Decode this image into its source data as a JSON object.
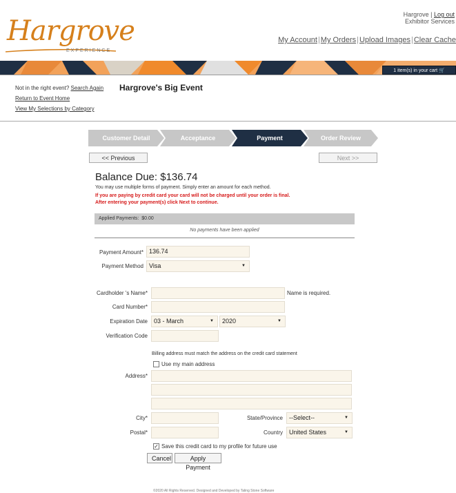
{
  "header": {
    "user_name": "Hargrove",
    "logout": "Log out",
    "exhibitor_services": "Exhibitor Services",
    "nav": [
      "My Account",
      "My Orders",
      "Upload Images",
      "Clear Cache"
    ],
    "logo_text": "Hargrove",
    "logo_sub": "EXPERIENCE",
    "cart": "1 item(s) in your cart"
  },
  "sidebar": {
    "wrong_event": "Not in the right event?",
    "search_again": "Search Again",
    "return_home": "Return to Event Home",
    "view_selections": "View My Selections by Category"
  },
  "event_title": "Hargrove's Big Event",
  "steps": [
    {
      "label": "Customer Detail"
    },
    {
      "label": "Acceptance"
    },
    {
      "label": "Payment"
    },
    {
      "label": "Order Review"
    }
  ],
  "nav_buttons": {
    "previous": "<< Previous",
    "next": "Next >>"
  },
  "balance": {
    "label": "Balance Due: $136.74",
    "note": "You may use multiple forms of payment. Simply enter an amount for each method.",
    "warn1": "If you are paying by credit card your card will not be charged until your order is final.",
    "warn2": "After entering your payment(s) click Next to continue."
  },
  "applied": {
    "label": "Applied Payments:",
    "amount": "$0.00",
    "empty": "No payments have been applied"
  },
  "payment": {
    "amount_label": "Payment Amount*",
    "amount_value": "136.74",
    "method_label": "Payment Method",
    "method_value": "Visa"
  },
  "card": {
    "holder_label": "Cardholder 's Name*",
    "holder_value": "",
    "holder_error": "Name is required.",
    "number_label": "Card Number*",
    "expiry_label": "Expiration Date",
    "expiry_month": "03 - March",
    "expiry_year": "2020",
    "cvv_label": "Verification Code"
  },
  "billing": {
    "note": "Billing address must match the address on the credit card statement",
    "use_main": "Use my main address",
    "address_label": "Address*",
    "city_label": "City*",
    "state_label": "State/Province",
    "state_value": "--Select--",
    "postal_label": "Postal*",
    "country_label": "Country",
    "country_value": "United States",
    "save_card": "Save this credit card to my profile for future use"
  },
  "actions": {
    "cancel": "Cancel",
    "apply": "Apply Payment"
  },
  "footer": "©2020 All Rights Reserved.   Designed and Developed by Taling Stone Software"
}
